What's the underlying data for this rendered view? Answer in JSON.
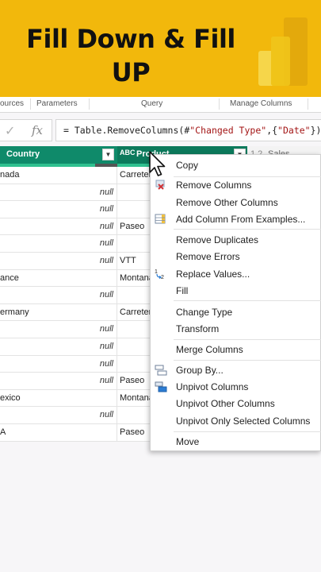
{
  "banner": {
    "title_line1": "Fill Down & Fill",
    "title_line2": "UP",
    "logo_icon": "power-bi-logo",
    "bg_color": "#f2b80c"
  },
  "ribbon": {
    "groups": [
      "ources",
      "Parameters",
      "Query",
      "Manage Columns"
    ]
  },
  "formula_bar": {
    "check_icon": "checkmark-icon",
    "fx_label": "fx",
    "formula_prefix": "= Table.RemoveColumns(#",
    "formula_str1": "\"Changed Type\"",
    "formula_mid": ",{",
    "formula_str2": "\"Date\"",
    "formula_suffix": "})"
  },
  "table": {
    "columns": [
      {
        "label": "Country",
        "type_icon": "dropdown-icon"
      },
      {
        "label": "Product",
        "type_icon": "ABC"
      },
      {
        "label": "Sales",
        "type_icon": "1.2"
      }
    ],
    "rows": [
      {
        "country": "nada",
        "country_null": "",
        "product": "Carretera"
      },
      {
        "country": "",
        "country_null": "null",
        "product": ""
      },
      {
        "country": "",
        "country_null": "null",
        "product": ""
      },
      {
        "country": "",
        "country_null": "null",
        "product": "Paseo"
      },
      {
        "country": "",
        "country_null": "null",
        "product": ""
      },
      {
        "country": "",
        "country_null": "null",
        "product": "VTT"
      },
      {
        "country": "ance",
        "country_null": "",
        "product": "Montana"
      },
      {
        "country": "",
        "country_null": "null",
        "product": ""
      },
      {
        "country": "ermany",
        "country_null": "",
        "product": "Carretera"
      },
      {
        "country": "",
        "country_null": "null",
        "product": ""
      },
      {
        "country": "",
        "country_null": "null",
        "product": ""
      },
      {
        "country": "",
        "country_null": "null",
        "product": ""
      },
      {
        "country": "",
        "country_null": "null",
        "product": "Paseo"
      },
      {
        "country": "exico",
        "country_null": "",
        "product": "Montana"
      },
      {
        "country": "",
        "country_null": "null",
        "product": ""
      },
      {
        "country": "A",
        "country_null": "",
        "product": "Paseo"
      }
    ]
  },
  "context_menu": {
    "items": [
      {
        "label": "Copy",
        "icon": "copy-icon"
      },
      {
        "label": "Remove Columns",
        "icon": "remove-columns-icon"
      },
      {
        "label": "Remove Other Columns",
        "icon": ""
      },
      {
        "label": "Add Column From Examples...",
        "icon": "add-column-examples-icon"
      },
      {
        "label": "Remove Duplicates",
        "icon": ""
      },
      {
        "label": "Remove Errors",
        "icon": ""
      },
      {
        "label": "Replace Values...",
        "icon": "replace-values-icon"
      },
      {
        "label": "Fill",
        "icon": ""
      },
      {
        "label": "Change Type",
        "icon": ""
      },
      {
        "label": "Transform",
        "icon": ""
      },
      {
        "label": "Merge Columns",
        "icon": ""
      },
      {
        "label": "Group By...",
        "icon": "group-by-icon"
      },
      {
        "label": "Unpivot Columns",
        "icon": "unpivot-icon"
      },
      {
        "label": "Unpivot Other Columns",
        "icon": ""
      },
      {
        "label": "Unpivot Only Selected Columns",
        "icon": ""
      },
      {
        "label": "Move",
        "icon": ""
      }
    ]
  }
}
